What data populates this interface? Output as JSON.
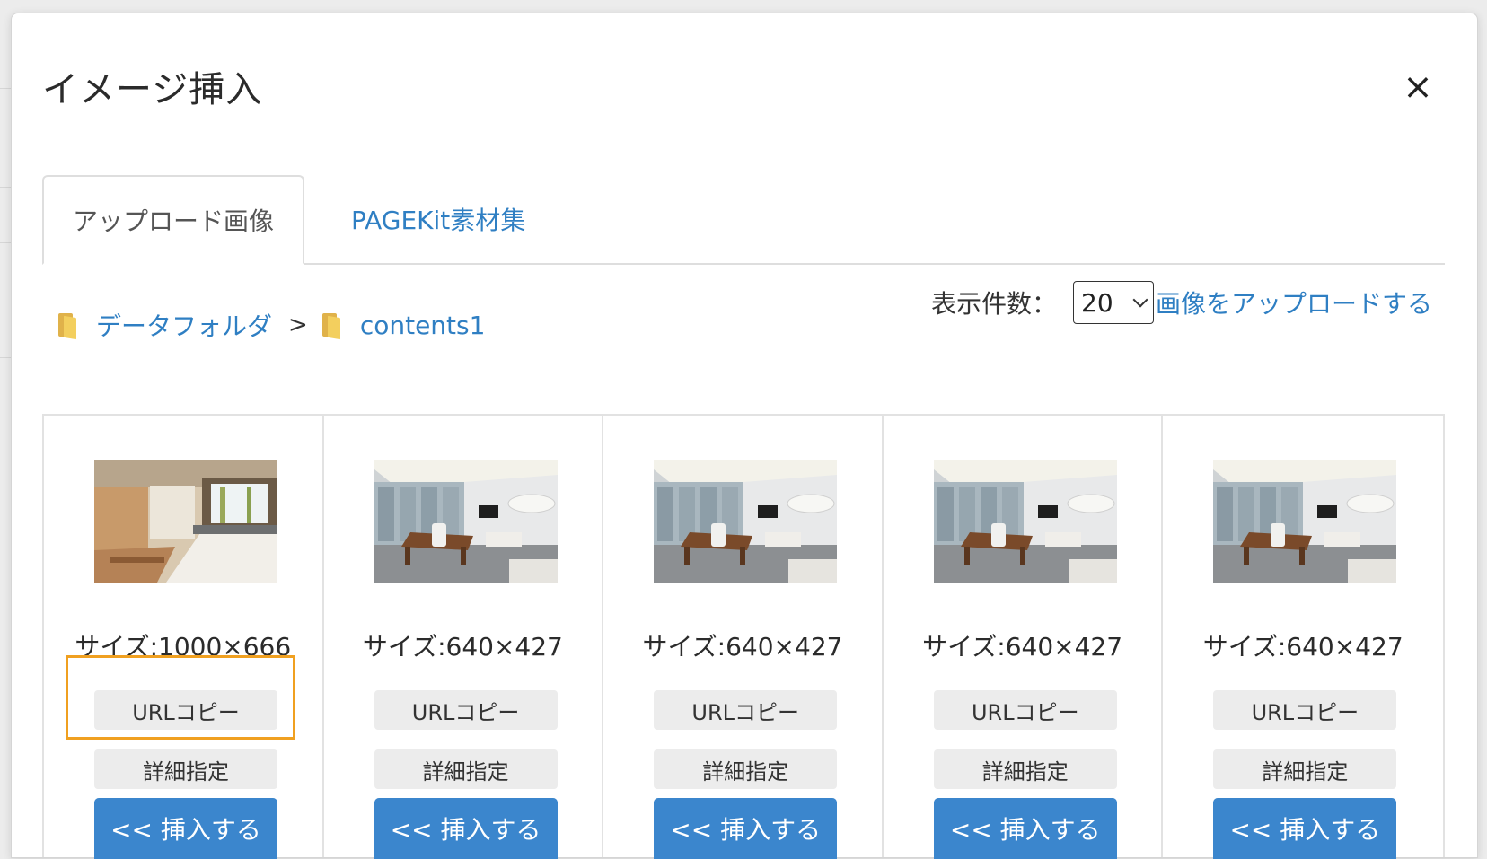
{
  "modal": {
    "title": "イメージ挿入",
    "close_symbol": "×"
  },
  "tabs": [
    {
      "label": "アップロード画像",
      "active": true
    },
    {
      "label": "PAGEKit素材集",
      "active": false
    }
  ],
  "breadcrumb": {
    "items": [
      "データフォルダ",
      "contents1"
    ],
    "separator": ">"
  },
  "per_page": {
    "label": "表示件数：",
    "value": "20"
  },
  "upload_link": "画像をアップロードする",
  "images": [
    {
      "size": "サイズ:1000×666",
      "kind": "kitchen"
    },
    {
      "size": "サイズ:640×427",
      "kind": "office"
    },
    {
      "size": "サイズ:640×427",
      "kind": "office"
    },
    {
      "size": "サイズ:640×427",
      "kind": "office"
    },
    {
      "size": "サイズ:640×427",
      "kind": "office"
    }
  ],
  "buttons": {
    "url_copy": "URLコピー",
    "detail": "詳細指定",
    "insert": "<< 挿入する"
  },
  "colors": {
    "link": "#2f7fc3",
    "insert_button": "#3b86cd",
    "highlight": "#f0a020"
  },
  "icons": [
    "close-icon",
    "folder-icon",
    "chevron-down-icon"
  ]
}
